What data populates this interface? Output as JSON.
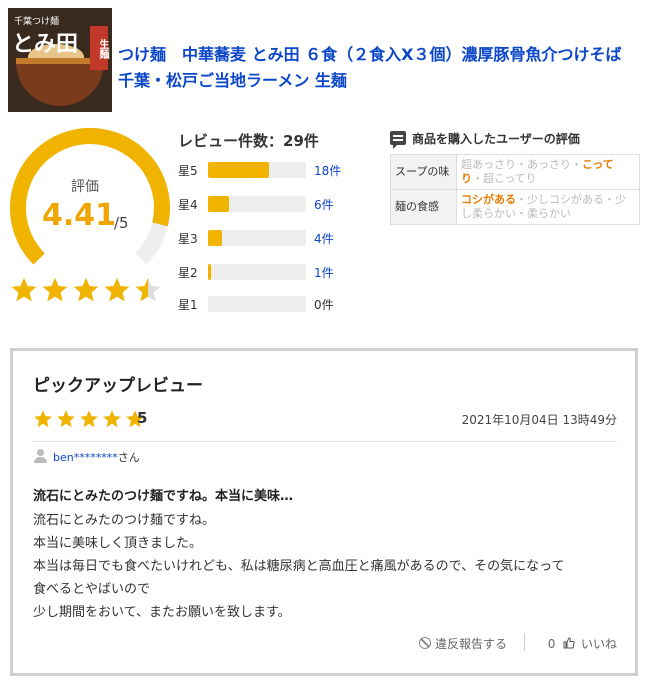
{
  "product": {
    "title": "つけ麺　中華蕎麦 とみ田 ６食（２食入X３個）濃厚豚骨魚介つけそば　千葉・松戸ご当地ラーメン 生麺",
    "thumbnail": {
      "brand_small": "千葉つけ麺",
      "brand_big": "とみ田",
      "badge": "生麺"
    }
  },
  "rating": {
    "label": "評価",
    "value": "4.41",
    "max": "/5",
    "fraction": 0.882,
    "stars": 4.41,
    "accent": "#f0b400"
  },
  "distribution": {
    "title": "レビュー件数：29件",
    "rows": [
      {
        "label": "星5",
        "count": "18件",
        "share": 0.62
      },
      {
        "label": "星4",
        "count": "6件",
        "share": 0.21
      },
      {
        "label": "星3",
        "count": "4件",
        "share": 0.14
      },
      {
        "label": "星2",
        "count": "1件",
        "share": 0.03
      },
      {
        "label": "星1",
        "count": "0件",
        "share": 0.0
      }
    ]
  },
  "buyer_eval": {
    "title": "商品を購入したユーザーの評価",
    "rows": [
      {
        "head": "スープの味",
        "options": [
          "超あっさり",
          "あっさり",
          "こってり",
          "超こってり"
        ],
        "selected": "こってり"
      },
      {
        "head": "麺の食感",
        "options": [
          "コシがある",
          "少しコシがある",
          "少し柔らかい",
          "柔らかい"
        ],
        "selected": "コシがある"
      }
    ]
  },
  "pickup": {
    "heading": "ピックアップレビュー",
    "stars": 5,
    "score": "5",
    "date": "2021年10月04日 13時49分",
    "reviewer_name": "ben********",
    "reviewer_suffix": "さん",
    "title": "流石にとみたのつけ麺ですね。本当に美味…",
    "body_lines": [
      "流石にとみたのつけ麺ですね。",
      "本当に美味しく頂きました。",
      "本当は毎日でも食べたいけれども、私は糖尿病と高血圧と痛風があるので、その気になって",
      "食べるとやばいので",
      "少し期間をおいて、またお願いを致します。"
    ],
    "report_label": "違反報告する",
    "like_count": "0",
    "like_label": "いいね"
  }
}
